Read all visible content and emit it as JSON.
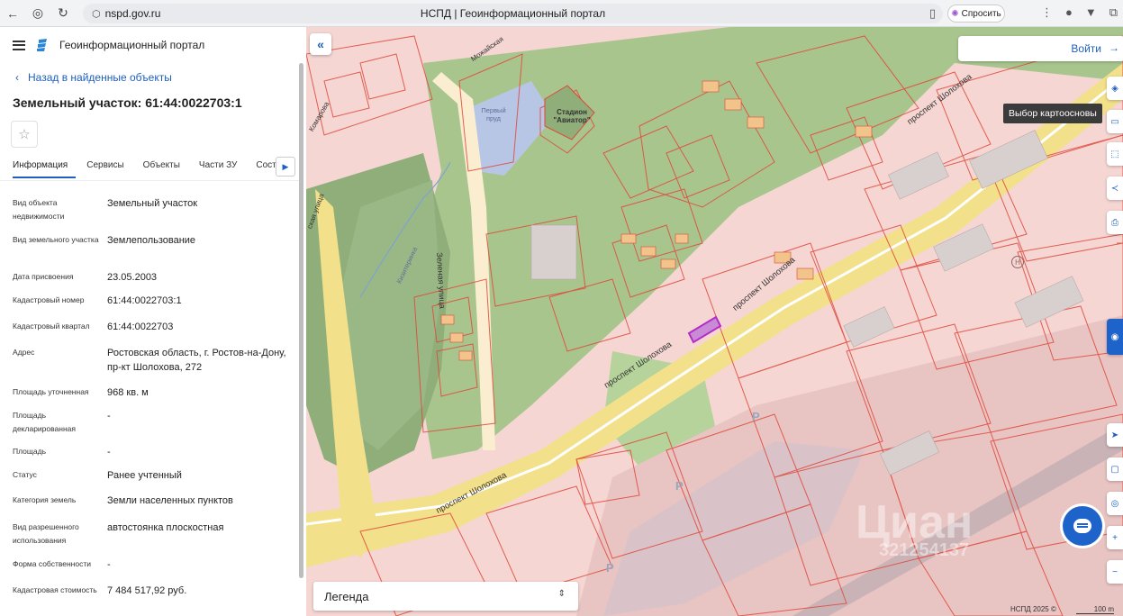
{
  "browser": {
    "url": "nspd.gov.ru",
    "tab_title": "НСПД | Геоинформационный портал",
    "ask_label": "Спросить"
  },
  "header": {
    "portal_title": "Геоинформационный портал",
    "back_label": "Назад в найденные объекты"
  },
  "object": {
    "title": "Земельный участок: 61:44:0022703:1"
  },
  "tabs": [
    "Информация",
    "Сервисы",
    "Объекты",
    "Части ЗУ",
    "Соста"
  ],
  "attributes": [
    {
      "key": "Вид объекта недвижимости",
      "value": "Земельный участок"
    },
    {
      "key": "Вид земельного участка",
      "value": "Землепользование"
    },
    {
      "key": "Дата присвоения",
      "value": "23.05.2003"
    },
    {
      "key": "Кадастровый номер",
      "value": "61:44:0022703:1"
    },
    {
      "key": "Кадастровый квартал",
      "value": "61:44:0022703"
    },
    {
      "key": "Адрес",
      "value": "Ростовская область, г. Ростов-на-Дону, пр-кт Шолохова, 272"
    },
    {
      "key": "Площадь уточненная",
      "value": "968 кв. м"
    },
    {
      "key": "Площадь декларированная",
      "value": "-"
    },
    {
      "key": "Площадь",
      "value": "-"
    },
    {
      "key": "Статус",
      "value": "Ранее учтенный"
    },
    {
      "key": "Категория земель",
      "value": "Земли населенных пунктов"
    },
    {
      "key": "Вид разрешенного использования",
      "value": "автостоянка плоскостная"
    },
    {
      "key": "Форма собственности",
      "value": "-"
    },
    {
      "key": "Кадастровая стоимость",
      "value": "7 484 517,92 руб."
    }
  ],
  "map": {
    "login_label": "Войти",
    "tooltip": "Выбор картоосновы",
    "legend_label": "Легенда",
    "attribution": "НСПД 2025 ©",
    "scale_label": "100 m",
    "watermark": "Циан",
    "watermark_number": "321254137",
    "labels": {
      "pond": "Первый пруд",
      "stadium": "Стадион \"Авиатор\"",
      "street_zelenaya": "Зеленая улица",
      "avenue_1": "проспект Шолохова",
      "avenue_2": "проспект Шолохова",
      "avenue_3": "проспект Шолохова",
      "avenue_4": "проспект Шолохова",
      "street_top": "Можайская",
      "street_left": "ская улица",
      "street_left2": "Комарова",
      "creek": "Кизитеринка"
    },
    "parking_letter": "P",
    "metro_letter": "Н"
  },
  "colors": {
    "accent": "#1f5fbf",
    "parcel_stroke": "#e0473a",
    "selected_parcel": "#b22fc7",
    "park": "#9fbf86",
    "road": "#f2e08a"
  }
}
